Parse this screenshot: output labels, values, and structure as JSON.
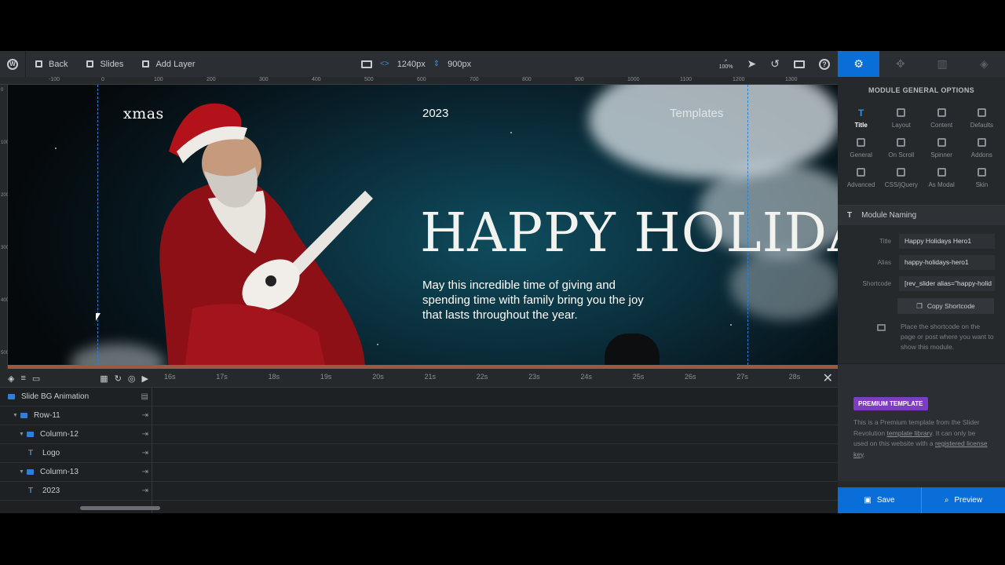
{
  "toolbar": {
    "back_label": "Back",
    "slides_label": "Slides",
    "add_layer_label": "Add Layer",
    "width_value": "1240px",
    "height_value": "900px",
    "zoom_label": "100%"
  },
  "panel_tabs": [
    "settings-icon",
    "slide-icon",
    "layers-icon",
    "stack-icon"
  ],
  "ruler": {
    "h_ticks": [
      "-100",
      "0",
      "100",
      "200",
      "300",
      "400",
      "500",
      "600",
      "700",
      "800",
      "900",
      "1000",
      "1100",
      "1200",
      "1300"
    ],
    "v_ticks": [
      "0",
      "100",
      "200",
      "300",
      "400",
      "500"
    ]
  },
  "canvas": {
    "logo_text": "xmas",
    "year_text": "2023",
    "templates_text": "Templates",
    "headline": "HAPPY HOLIDAYS",
    "body": "May this incredible time of giving and spending time with family bring you the joy that lasts throughout the year."
  },
  "timeline": {
    "times": [
      "16s",
      "17s",
      "18s",
      "19s",
      "20s",
      "21s",
      "22s",
      "23s",
      "24s",
      "25s",
      "26s",
      "27s",
      "28s"
    ],
    "layers": [
      {
        "label": "Slide BG Animation",
        "type": "slide",
        "indent": 0
      },
      {
        "label": "Row-11",
        "type": "row",
        "indent": 1
      },
      {
        "label": "Column-12",
        "type": "column",
        "indent": 2
      },
      {
        "label": "Logo",
        "type": "text",
        "indent": 3
      },
      {
        "label": "Column-13",
        "type": "column",
        "indent": 2
      },
      {
        "label": "2023",
        "type": "text",
        "indent": 3
      }
    ]
  },
  "panel": {
    "title": "MODULE GENERAL OPTIONS",
    "options": [
      {
        "label": "Title",
        "icon": "title-icon",
        "active": true
      },
      {
        "label": "Layout",
        "icon": "layout-icon"
      },
      {
        "label": "Content",
        "icon": "content-icon"
      },
      {
        "label": "Defaults",
        "icon": "defaults-icon"
      },
      {
        "label": "General",
        "icon": "wrench-icon"
      },
      {
        "label": "On Scroll",
        "icon": "scroll-icon"
      },
      {
        "label": "Spinner",
        "icon": "spinner-icon"
      },
      {
        "label": "Addons",
        "icon": "puzzle-icon"
      },
      {
        "label": "Advanced",
        "icon": "chart-icon"
      },
      {
        "label": "CSS/jQuery",
        "icon": "code-icon"
      },
      {
        "label": "As Modal",
        "icon": "modal-icon"
      },
      {
        "label": "Skin",
        "icon": "brush-icon"
      }
    ],
    "naming_section": "Module Naming",
    "fields": {
      "title_label": "Title",
      "title_value": "Happy Holidays Hero1",
      "alias_label": "Alias",
      "alias_value": "happy-holidays-hero1",
      "shortcode_label": "Shortcode",
      "shortcode_value": "[rev_slider alias=\"happy-holid"
    },
    "copy_label": "Copy Shortcode",
    "hint": "Place the shortcode on the page or post where you want to show this module.",
    "premium_badge": "PREMIUM TEMPLATE",
    "premium_text_1": "This is a Premium template from the Slider Revolution ",
    "premium_link_1": "template library",
    "premium_text_2": ". It can only be used on this website with a ",
    "premium_link_2": "registered license key",
    "premium_text_3": ".",
    "save_label": "Save",
    "preview_label": "Preview"
  },
  "colors": {
    "accent": "#0a6ed8",
    "premium": "#7d3cc4"
  }
}
